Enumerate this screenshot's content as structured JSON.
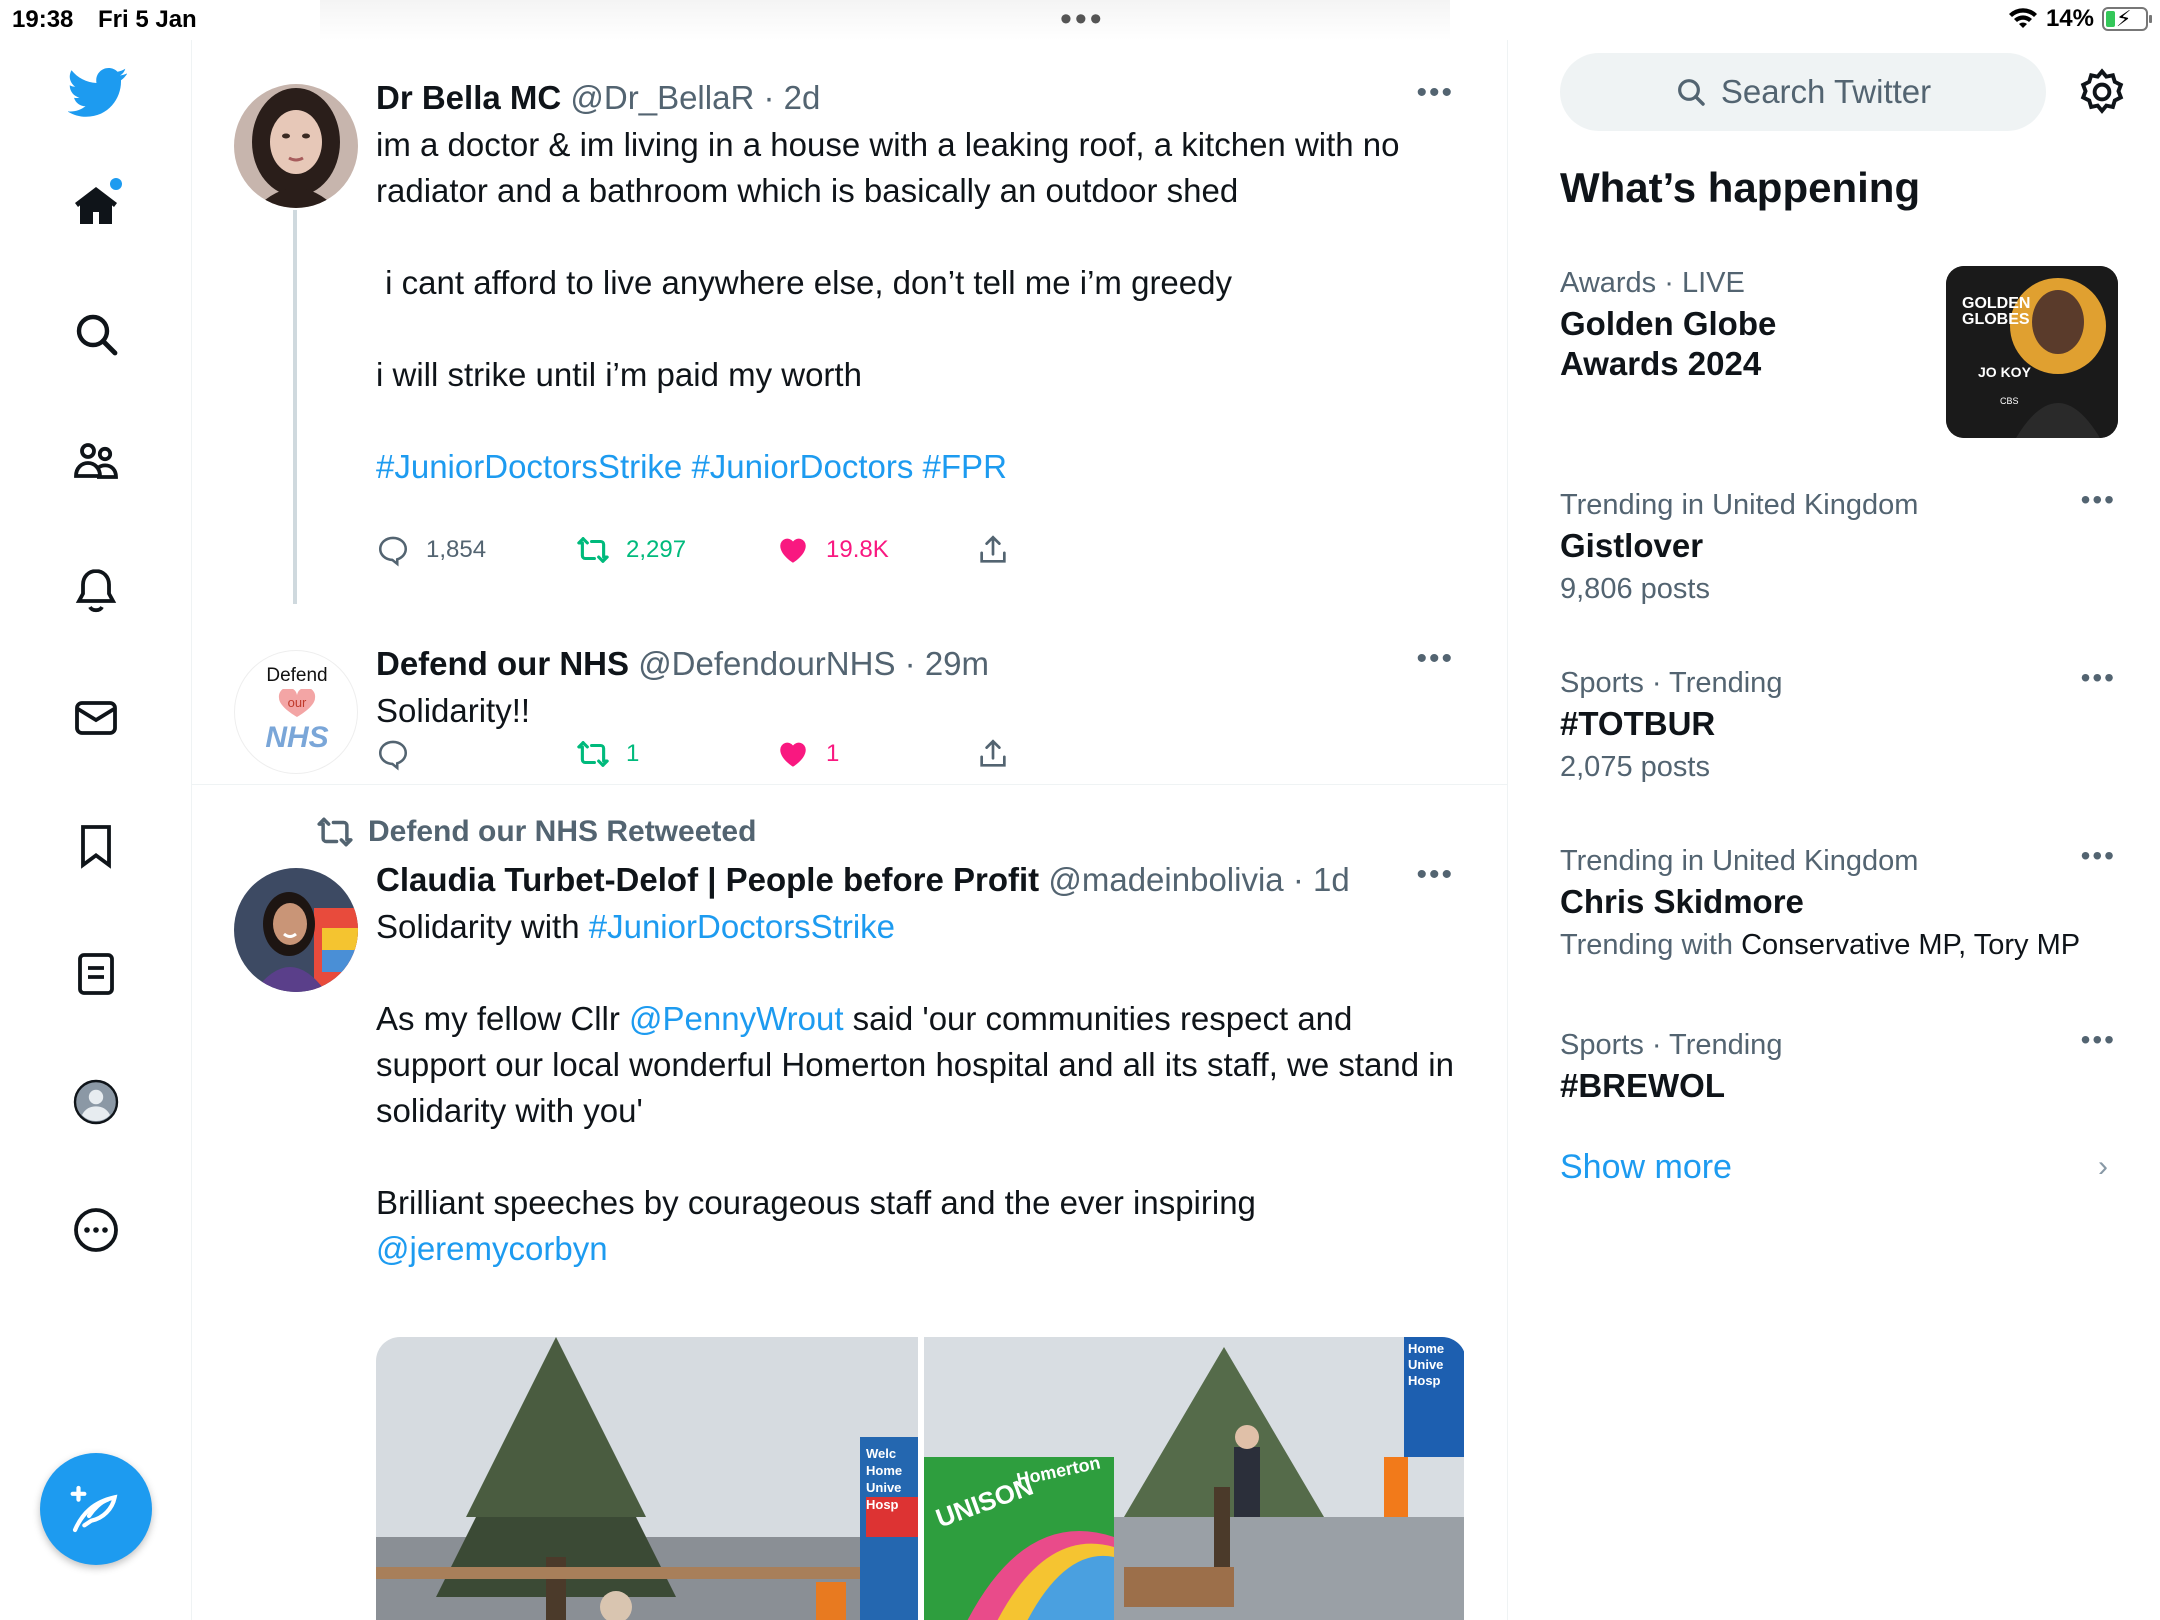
{
  "status_bar": {
    "time": "19:38",
    "date": "Fri 5 Jan",
    "battery": "14%",
    "battery_level": 0.14
  },
  "sidebar": {
    "nav": [
      {
        "id": "home",
        "icon": "home-icon",
        "has_badge": true
      },
      {
        "id": "explore",
        "icon": "search-icon"
      },
      {
        "id": "communities",
        "icon": "communities-icon"
      },
      {
        "id": "notifications",
        "icon": "bell-icon"
      },
      {
        "id": "messages",
        "icon": "mail-icon"
      },
      {
        "id": "bookmarks",
        "icon": "bookmark-icon"
      },
      {
        "id": "lists",
        "icon": "list-icon"
      },
      {
        "id": "profile",
        "icon": "profile-icon"
      },
      {
        "id": "more",
        "icon": "more-circle-icon"
      }
    ]
  },
  "tweets": [
    {
      "name": "Dr Bella MC",
      "handle": "@Dr_BellaR",
      "time": "2d",
      "paragraphs": [
        "im a doctor & im living in a house with a leaking roof, a kitchen with no radiator and a bathroom which is basically an outdoor shed",
        " i cant afford to live anywhere else, don’t tell me i’m greedy",
        "i will strike until i’m paid my worth"
      ],
      "hashtags": "#JuniorDoctorsStrike #JuniorDoctors #FPR",
      "replies": "1,854",
      "retweets": "2,297",
      "likes": "19.8K"
    },
    {
      "name": "Defend our NHS",
      "handle": "@DefendourNHS",
      "time": "29m",
      "text": "Solidarity!!",
      "avatar_lines": [
        "Defend",
        "our",
        "NHS"
      ],
      "replies": "",
      "retweets": "1",
      "likes": "1"
    },
    {
      "retweeted_by": "Defend our NHS Retweeted",
      "name": "Claudia Turbet-Delof | People before Profit",
      "handle": "@madeinbolivia",
      "time": "1d",
      "line1_text": "Solidarity with ",
      "line1_tag": "#JuniorDoctorsStrike",
      "p2_pre": "As my fellow Cllr ",
      "p2_mention": "@PennyWrout",
      "p2_post": " said 'our communities respect and support our local wonderful Homerton hospital and all its staff, we stand in solidarity with you'",
      "p3_text": "Brilliant speeches by courageous staff and the ever inspiring",
      "p3_mention": "@jeremycorbyn",
      "media_sign": [
        "Welc",
        "Home",
        "Unive",
        "Hosp"
      ],
      "media_sign2": [
        "Home",
        "Unive",
        "Hosp"
      ],
      "media_banner": [
        "UNISON",
        "Homerton"
      ]
    }
  ],
  "right": {
    "search_placeholder": "Search Twitter",
    "section_title": "What’s happening",
    "trends": [
      {
        "category": "Awards",
        "qualifier": "LIVE",
        "title_lines": [
          "Golden Globe",
          "Awards 2024"
        ],
        "thumb_lines": [
          "GOLDEN",
          "GLOBES",
          "JO KOY",
          "CBS"
        ]
      },
      {
        "category": "Trending in United Kingdom",
        "title": "Gistlover",
        "sub": "9,806 posts"
      },
      {
        "category": "Sports · Trending",
        "title": "#TOTBUR",
        "sub": "2,075 posts"
      },
      {
        "category": "Trending in United Kingdom",
        "title": "Chris Skidmore",
        "sub_label": "Trending with ",
        "sub_dark": "Conservative MP, Tory MP"
      },
      {
        "category": "Sports · Trending",
        "title": "#BREWOL"
      }
    ],
    "show_more": "Show more"
  },
  "colors": {
    "accent": "#1d9bf0",
    "retweet": "#00ba7c",
    "like": "#f91880",
    "muted": "#536471"
  }
}
